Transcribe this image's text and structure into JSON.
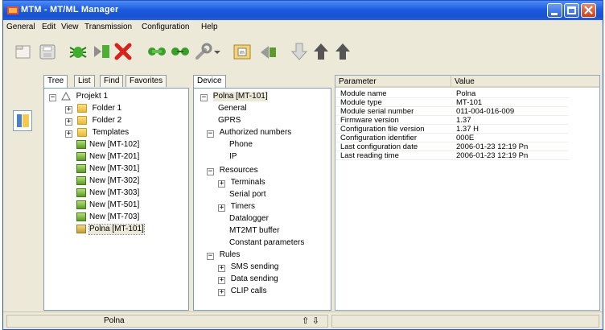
{
  "window": {
    "title": "MTM - MT/ML Manager",
    "accent": "#1e5ce0"
  },
  "menu": {
    "items": [
      "General",
      "Edit",
      "View",
      "Transmission",
      "Configuration",
      "Help"
    ]
  },
  "toolbar": {
    "icons": [
      "new-document-icon",
      "save-icon",
      "connect-bug-icon",
      "disconnect-icon",
      "delete-icon",
      "link-green-icon",
      "link-green-2-icon",
      "wrench-icon",
      "dropdown-icon",
      "read-module-icon",
      "transfer-icon",
      "download-arrow-icon",
      "upload-arrow-icon",
      "upload-arrow-2-icon"
    ]
  },
  "left_tabs": [
    "Tree",
    "List",
    "Find",
    "Favorites"
  ],
  "project_tree": {
    "root": "Projekt 1",
    "folders": [
      "Folder 1",
      "Folder 2",
      "Templates"
    ],
    "devices": [
      "New [MT-102]",
      "New [MT-201]",
      "New [MT-301]",
      "New [MT-302]",
      "New [MT-303]",
      "New [MT-501]",
      "New [MT-703]",
      "Polna [MT-101]"
    ]
  },
  "device_tab": "Device",
  "device_tree": {
    "root": "Polna [MT-101]",
    "general": "General",
    "gprs": "GPRS",
    "authorized": "Authorized numbers",
    "phone": "Phone",
    "ip": "IP",
    "resources": "Resources",
    "terminals": "Terminals",
    "serial": "Serial port",
    "timers": "Timers",
    "datalogger": "Datalogger",
    "mt2mt": "MT2MT buffer",
    "constants": "Constant parameters",
    "rules": "Rules",
    "sms": "SMS sending",
    "data": "Data sending",
    "clip": "CLIP calls"
  },
  "params": {
    "header_param": "Parameter",
    "header_value": "Value",
    "rows": [
      {
        "p": "Module name",
        "v": "Polna"
      },
      {
        "p": "Module type",
        "v": "MT-101"
      },
      {
        "p": "Module serial number",
        "v": "011-004-016-009"
      },
      {
        "p": "Firmware version",
        "v": "1.37"
      },
      {
        "p": "Configuration file version",
        "v": "1.37 H"
      },
      {
        "p": "Configuration identifier",
        "v": "000E"
      },
      {
        "p": "Last configuration date",
        "v": "2006-01-23 12:19 Pn"
      },
      {
        "p": "Last reading time",
        "v": "2006-01-23 12:19 Pn"
      }
    ]
  },
  "status": {
    "module": "Polna",
    "arrows": "⇧ ⇩"
  }
}
